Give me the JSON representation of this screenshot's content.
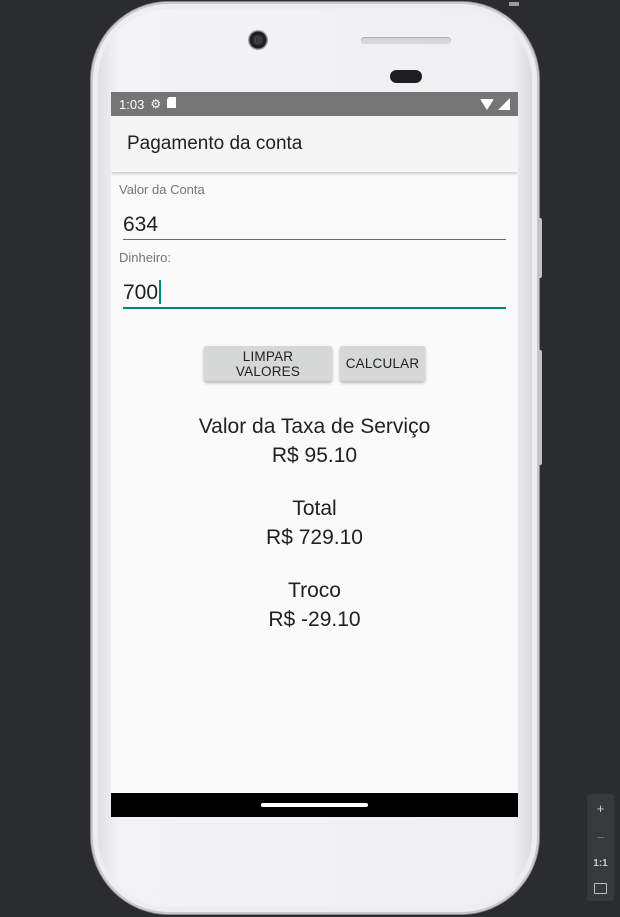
{
  "status_bar": {
    "time": "1:03",
    "icons": [
      "settings-icon",
      "sd-card-icon",
      "wifi-icon",
      "signal-icon"
    ]
  },
  "app_bar": {
    "title": "Pagamento da conta"
  },
  "form": {
    "bill_label": "Valor da Conta",
    "bill_value": "634",
    "cash_label": "Dinheiro:",
    "cash_value": "700"
  },
  "buttons": {
    "clear_label": "LIMPAR VALORES",
    "calculate_label": "CALCULAR"
  },
  "results": {
    "service_fee_label": "Valor da Taxa de Serviço",
    "service_fee_value": "R$ 95.10",
    "total_label": "Total",
    "total_value": "R$ 729.10",
    "change_label": "Troco",
    "change_value": "R$ -29.10"
  },
  "emulator_zoom": {
    "zoom_in": "+",
    "zoom_out": "−",
    "actual_size": "1:1"
  },
  "colors": {
    "accent": "#00897b",
    "status_bar": "#757575",
    "app_bar": "#f5f5f5",
    "button": "#d6d7d7"
  }
}
